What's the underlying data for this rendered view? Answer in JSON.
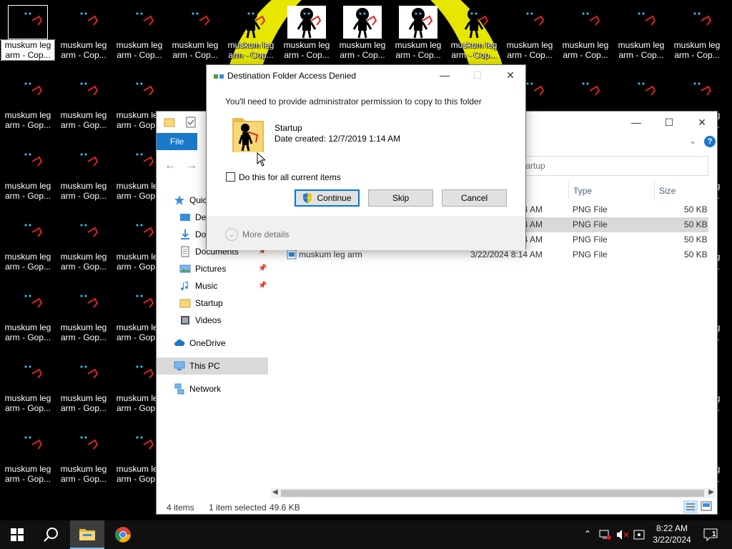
{
  "desktop": {
    "icon_label_line1": "muskum leg",
    "icon_label_line2": "arm - Cop...",
    "icon_label_line2_trunc": "arm - Gop..."
  },
  "explorer": {
    "ribbon_file": "File",
    "search_placeholder": "Search Startup",
    "search_visible_text": "tartup",
    "nav": {
      "quick_access": "Quic",
      "desktop": "Des",
      "downloads": "Do",
      "documents": "Documents",
      "pictures": "Pictures",
      "music": "Music",
      "startup": "Startup",
      "videos": "Videos",
      "onedrive": "OneDrive",
      "this_pc": "This PC",
      "network": "Network"
    },
    "columns": {
      "type": "Type",
      "size": "Size"
    },
    "rows": [
      {
        "date": "8:14 AM",
        "type": "PNG File",
        "size": "50 KB",
        "selected": false
      },
      {
        "date": "8:14 AM",
        "type": "PNG File",
        "size": "50 KB",
        "selected": true
      },
      {
        "date": "8:14 AM",
        "type": "PNG File",
        "size": "50 KB",
        "selected": false
      },
      {
        "name": "muskum leg arm",
        "date": "3/22/2024 8:14 AM",
        "type": "PNG File",
        "size": "50 KB",
        "selected": false
      }
    ],
    "status": {
      "items": "4 items",
      "selected": "1 item selected",
      "size": "49.6 KB"
    }
  },
  "dialog": {
    "title": "Destination Folder Access Denied",
    "message": "You'll need to provide administrator permission to copy to this folder",
    "folder_name": "Startup",
    "folder_date": "Date created: 12/7/2019 1:14 AM",
    "checkbox_label": "Do this for all current items",
    "checkbox_checked": false,
    "buttons": {
      "continue": "Continue",
      "skip": "Skip",
      "cancel": "Cancel"
    },
    "more_details": "More details"
  },
  "taskbar": {
    "time": "8:22 AM",
    "date": "3/22/2024",
    "notification_count": "1"
  },
  "colors": {
    "accent": "#0078d7",
    "file_tab": "#1979ca",
    "selection": "#d9d9d9",
    "taskbar": "#101010",
    "wallpaper_yellow": "#e6e600"
  }
}
